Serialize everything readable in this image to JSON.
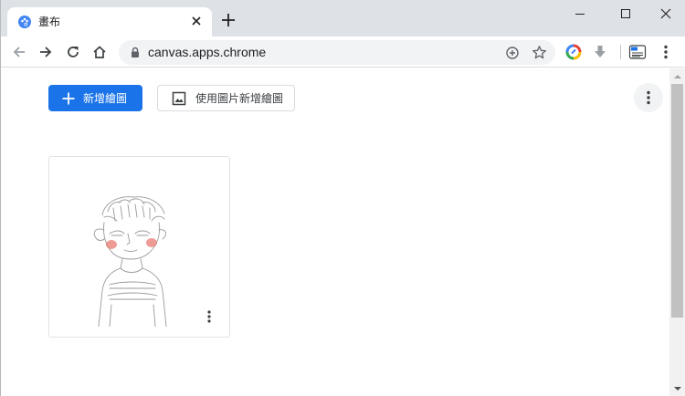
{
  "browser": {
    "tab": {
      "title": "畫布",
      "favicon": "palette-icon",
      "close_icon": "close-icon"
    },
    "new_tab_icon": "plus-icon",
    "window_controls": [
      "minimize-icon",
      "maximize-icon",
      "close-icon"
    ],
    "toolbar": {
      "back_icon": "arrow-back-icon",
      "forward_icon": "arrow-forward-icon",
      "reload_icon": "reload-icon",
      "home_icon": "home-icon",
      "url": "canvas.apps.chrome",
      "omnibox_icons": [
        "zoom-plus-icon",
        "star-icon"
      ],
      "extension_icons": [
        "google-one-icon",
        "download-icon",
        "keyboard-icon"
      ],
      "menu_icon": "more-vert-icon"
    }
  },
  "page": {
    "new_drawing_label": "新增繪圖",
    "new_from_image_label": "使用圖片新增繪圖",
    "menu_icon": "more-vert-icon",
    "drawings": [
      {
        "thumbnail": "sketch-of-boy-with-blush",
        "menu_icon": "more-vert-icon"
      }
    ]
  },
  "colors": {
    "primary": "#1a73e8",
    "tabstrip": "#dee1e6",
    "omnibox": "#f1f3f4",
    "blush": "#e87a72"
  }
}
